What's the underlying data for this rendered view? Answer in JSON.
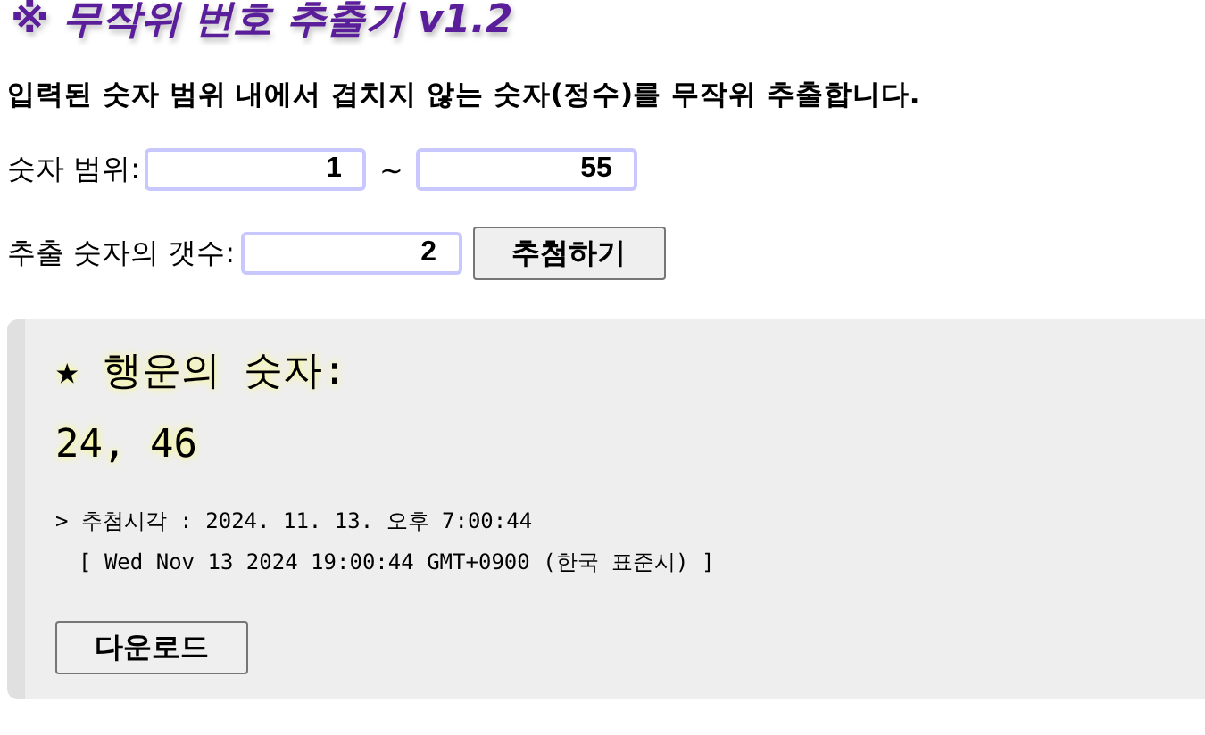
{
  "title": "※ 무작위 번호 추출기 v1.2",
  "description": "입력된 숫자 범위 내에서 겹치지 않는 숫자(정수)를 무작위 추출합니다.",
  "range": {
    "label": "숫자 범위:",
    "min": "1",
    "separator": "~",
    "max": "55"
  },
  "count": {
    "label": "추출 숫자의 갯수:",
    "value": "2",
    "button": "추첨하기"
  },
  "result": {
    "heading": "★ 행운의 숫자:",
    "numbers": "24, 46",
    "time_line": "> 추첨시각 : 2024. 11. 13. 오후 7:00:44",
    "raw_time": "[ Wed Nov 13 2024 19:00:44 GMT+0900 (한국 표준시) ]",
    "download_button": "다운로드"
  }
}
